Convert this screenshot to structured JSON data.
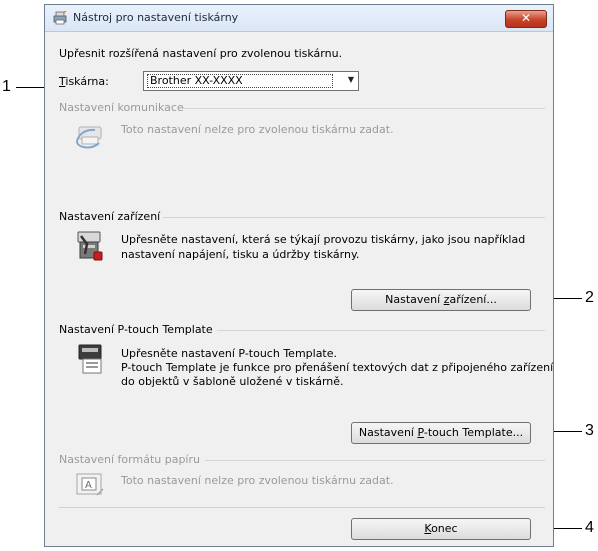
{
  "window": {
    "title": "Nástroj pro nastavení tiskárny",
    "close_symbol": "✕",
    "intro": "Upřesnit rozšířená nastavení pro zvolenou tiskárnu."
  },
  "printer": {
    "label_prefix": "T",
    "label_rest": "iskárna:",
    "selected": "Brother XX-XXXX"
  },
  "sections": {
    "communication": {
      "title": "Nastavení komunikace",
      "text": "Toto nastavení nelze pro zvolenou tiskárnu zadat.",
      "icon": "communication-icon"
    },
    "device": {
      "title": "Nastavení zařízení",
      "text_line1": "Upřesněte nastavení, která se týkají provozu tiskárny, jako jsou například",
      "text_line2": "nastavení napájení, tisku a údržby tiskárny.",
      "button_prefix": "Nastavení ",
      "button_accel": "z",
      "button_rest": "ařízení...",
      "icon": "device-settings-icon"
    },
    "ptouch": {
      "title": "Nastavení P-touch Template",
      "text_line1": "Upřesněte nastavení P-touch Template.",
      "text_line2": "P-touch Template je funkce pro přenášení textových dat z připojeného zařízení",
      "text_line3": "do objektů v šabloně uložené v tiskárně.",
      "button_prefix": "Nastavení ",
      "button_accel": "P",
      "button_rest": "-touch Template...",
      "icon": "ptouch-template-icon"
    },
    "paper": {
      "title": "Nastavení formátu papíru",
      "text": "Toto nastavení nelze pro zvolenou tiskárnu zadat.",
      "icon": "paper-format-icon"
    }
  },
  "footer": {
    "button_accel": "K",
    "button_rest": "onec"
  },
  "callouts": [
    "1",
    "2",
    "3",
    "4"
  ]
}
